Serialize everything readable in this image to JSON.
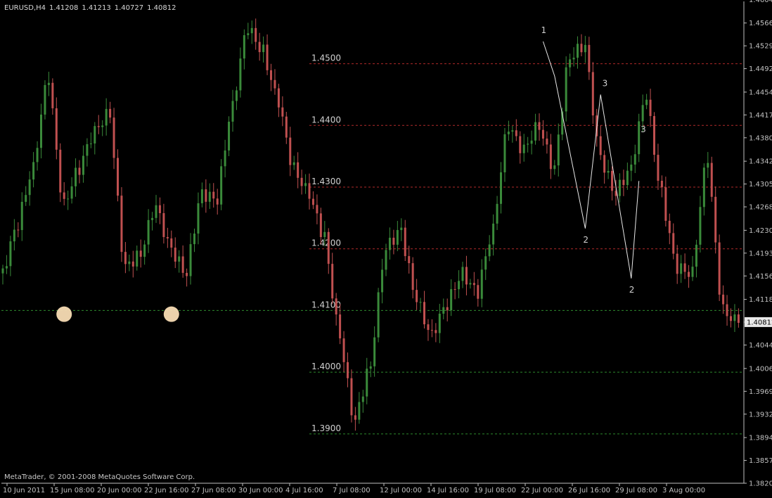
{
  "header": {
    "symbol": "EURUSD,H4",
    "open": "1.41208",
    "high": "1.41213",
    "low": "1.40727",
    "close": "1.40812"
  },
  "copyright": "MetaTrader, © 2001-2008 MetaQuotes Software Corp.",
  "colors": {
    "background": "#000000",
    "axis": "#c0c0c0",
    "bull": "#3a8a3a",
    "bear": "#c05050",
    "resistance": "#b02a2a",
    "support": "#2e8a2e",
    "label": "#d0d0d0",
    "marker": "#f8dcb4",
    "price_box": "#e8e8e8"
  },
  "chart_data": {
    "type": "candlestick",
    "symbol": "EURUSD",
    "timeframe": "H4",
    "ylim": [
      1.382,
      1.4601
    ],
    "price_ticks": [
      "1.46040",
      "1.45660",
      "1.45290",
      "1.44920",
      "1.44540",
      "1.44170",
      "1.43800",
      "1.43420",
      "1.43050",
      "1.42680",
      "1.42300",
      "1.41930",
      "1.41560",
      "1.41180",
      "1.40812",
      "1.40440",
      "1.40060",
      "1.39690",
      "1.39320",
      "1.38940",
      "1.38570",
      "1.38200"
    ],
    "time_ticks": [
      "10 Jun 2011",
      "15 Jun 08:00",
      "20 Jun 00:00",
      "22 Jun 16:00",
      "27 Jun 08:00",
      "30 Jun 00:00",
      "4 Jul 16:00",
      "7 Jul 08:00",
      "12 Jul 00:00",
      "14 Jul 16:00",
      "19 Jul 08:00",
      "22 Jul 00:00",
      "26 Jul 16:00",
      "29 Jul 08:00",
      "3 Aug 00:00"
    ],
    "current_price": "1.40812",
    "levels": [
      {
        "label": "1.4500",
        "price": 1.45,
        "kind": "resistance"
      },
      {
        "label": "1.4400",
        "price": 1.44,
        "kind": "resistance"
      },
      {
        "label": "1.4300",
        "price": 1.43,
        "kind": "resistance"
      },
      {
        "label": "1.4200",
        "price": 1.42,
        "kind": "resistance"
      },
      {
        "label": "1.4100",
        "price": 1.41,
        "kind": "support"
      },
      {
        "label": "1.4000",
        "price": 1.4,
        "kind": "support"
      },
      {
        "label": "1.3900",
        "price": 1.39,
        "kind": "support"
      }
    ],
    "pivot_prices": [
      1.416,
      1.424,
      1.433,
      1.448,
      1.427,
      1.433,
      1.439,
      1.442,
      1.417,
      1.419,
      1.427,
      1.42,
      1.416,
      1.429,
      1.428,
      1.443,
      1.456,
      1.452,
      1.444,
      1.433,
      1.429,
      1.422,
      1.406,
      1.392,
      1.401,
      1.42,
      1.423,
      1.412,
      1.406,
      1.411,
      1.416,
      1.413,
      1.423,
      1.44,
      1.436,
      1.44,
      1.433,
      1.451,
      1.453,
      1.435,
      1.429,
      1.433,
      1.445,
      1.429,
      1.417,
      1.416,
      1.435,
      1.41,
      1.408
    ],
    "wave_labels": [
      {
        "text": "1",
        "price": 1.4536,
        "bar": 141
      },
      {
        "text": "2",
        "price": 1.4233,
        "bar": 152
      },
      {
        "text": "3",
        "price": 1.445,
        "bar": 157
      },
      {
        "text": "2",
        "price": 1.4152,
        "bar": 164
      },
      {
        "text": "3",
        "price": 1.4375,
        "bar": 167
      }
    ],
    "zigzag": [
      {
        "bar": 141,
        "price": 1.4536
      },
      {
        "bar": 144,
        "price": 1.448
      },
      {
        "bar": 152,
        "price": 1.4233
      },
      {
        "bar": 156,
        "price": 1.445
      },
      {
        "bar": 164,
        "price": 1.4152
      },
      {
        "bar": 166,
        "price": 1.431
      }
    ],
    "circle_markers": [
      {
        "bar": 16,
        "price": 1.4094
      },
      {
        "bar": 44,
        "price": 1.4094
      }
    ]
  }
}
